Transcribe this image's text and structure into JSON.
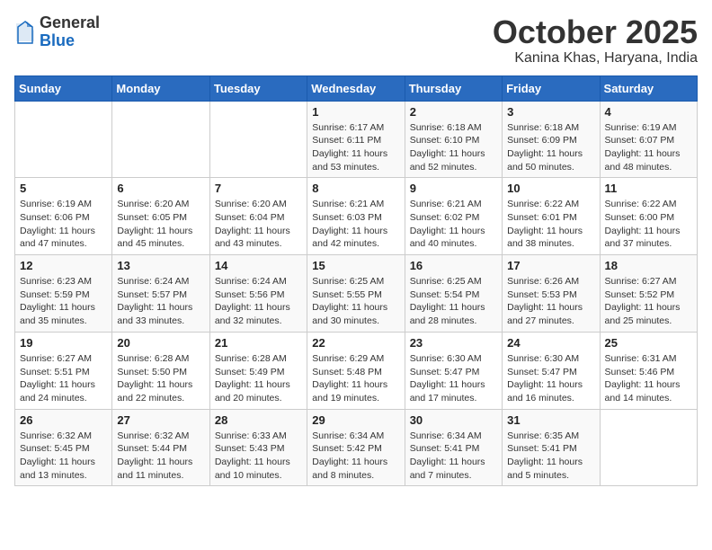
{
  "logo": {
    "general": "General",
    "blue": "Blue"
  },
  "title": "October 2025",
  "location": "Kanina Khas, Haryana, India",
  "days_of_week": [
    "Sunday",
    "Monday",
    "Tuesday",
    "Wednesday",
    "Thursday",
    "Friday",
    "Saturday"
  ],
  "weeks": [
    [
      {
        "day": "",
        "sunrise": "",
        "sunset": "",
        "daylight": ""
      },
      {
        "day": "",
        "sunrise": "",
        "sunset": "",
        "daylight": ""
      },
      {
        "day": "",
        "sunrise": "",
        "sunset": "",
        "daylight": ""
      },
      {
        "day": "1",
        "sunrise": "Sunrise: 6:17 AM",
        "sunset": "Sunset: 6:11 PM",
        "daylight": "Daylight: 11 hours and 53 minutes."
      },
      {
        "day": "2",
        "sunrise": "Sunrise: 6:18 AM",
        "sunset": "Sunset: 6:10 PM",
        "daylight": "Daylight: 11 hours and 52 minutes."
      },
      {
        "day": "3",
        "sunrise": "Sunrise: 6:18 AM",
        "sunset": "Sunset: 6:09 PM",
        "daylight": "Daylight: 11 hours and 50 minutes."
      },
      {
        "day": "4",
        "sunrise": "Sunrise: 6:19 AM",
        "sunset": "Sunset: 6:07 PM",
        "daylight": "Daylight: 11 hours and 48 minutes."
      }
    ],
    [
      {
        "day": "5",
        "sunrise": "Sunrise: 6:19 AM",
        "sunset": "Sunset: 6:06 PM",
        "daylight": "Daylight: 11 hours and 47 minutes."
      },
      {
        "day": "6",
        "sunrise": "Sunrise: 6:20 AM",
        "sunset": "Sunset: 6:05 PM",
        "daylight": "Daylight: 11 hours and 45 minutes."
      },
      {
        "day": "7",
        "sunrise": "Sunrise: 6:20 AM",
        "sunset": "Sunset: 6:04 PM",
        "daylight": "Daylight: 11 hours and 43 minutes."
      },
      {
        "day": "8",
        "sunrise": "Sunrise: 6:21 AM",
        "sunset": "Sunset: 6:03 PM",
        "daylight": "Daylight: 11 hours and 42 minutes."
      },
      {
        "day": "9",
        "sunrise": "Sunrise: 6:21 AM",
        "sunset": "Sunset: 6:02 PM",
        "daylight": "Daylight: 11 hours and 40 minutes."
      },
      {
        "day": "10",
        "sunrise": "Sunrise: 6:22 AM",
        "sunset": "Sunset: 6:01 PM",
        "daylight": "Daylight: 11 hours and 38 minutes."
      },
      {
        "day": "11",
        "sunrise": "Sunrise: 6:22 AM",
        "sunset": "Sunset: 6:00 PM",
        "daylight": "Daylight: 11 hours and 37 minutes."
      }
    ],
    [
      {
        "day": "12",
        "sunrise": "Sunrise: 6:23 AM",
        "sunset": "Sunset: 5:59 PM",
        "daylight": "Daylight: 11 hours and 35 minutes."
      },
      {
        "day": "13",
        "sunrise": "Sunrise: 6:24 AM",
        "sunset": "Sunset: 5:57 PM",
        "daylight": "Daylight: 11 hours and 33 minutes."
      },
      {
        "day": "14",
        "sunrise": "Sunrise: 6:24 AM",
        "sunset": "Sunset: 5:56 PM",
        "daylight": "Daylight: 11 hours and 32 minutes."
      },
      {
        "day": "15",
        "sunrise": "Sunrise: 6:25 AM",
        "sunset": "Sunset: 5:55 PM",
        "daylight": "Daylight: 11 hours and 30 minutes."
      },
      {
        "day": "16",
        "sunrise": "Sunrise: 6:25 AM",
        "sunset": "Sunset: 5:54 PM",
        "daylight": "Daylight: 11 hours and 28 minutes."
      },
      {
        "day": "17",
        "sunrise": "Sunrise: 6:26 AM",
        "sunset": "Sunset: 5:53 PM",
        "daylight": "Daylight: 11 hours and 27 minutes."
      },
      {
        "day": "18",
        "sunrise": "Sunrise: 6:27 AM",
        "sunset": "Sunset: 5:52 PM",
        "daylight": "Daylight: 11 hours and 25 minutes."
      }
    ],
    [
      {
        "day": "19",
        "sunrise": "Sunrise: 6:27 AM",
        "sunset": "Sunset: 5:51 PM",
        "daylight": "Daylight: 11 hours and 24 minutes."
      },
      {
        "day": "20",
        "sunrise": "Sunrise: 6:28 AM",
        "sunset": "Sunset: 5:50 PM",
        "daylight": "Daylight: 11 hours and 22 minutes."
      },
      {
        "day": "21",
        "sunrise": "Sunrise: 6:28 AM",
        "sunset": "Sunset: 5:49 PM",
        "daylight": "Daylight: 11 hours and 20 minutes."
      },
      {
        "day": "22",
        "sunrise": "Sunrise: 6:29 AM",
        "sunset": "Sunset: 5:48 PM",
        "daylight": "Daylight: 11 hours and 19 minutes."
      },
      {
        "day": "23",
        "sunrise": "Sunrise: 6:30 AM",
        "sunset": "Sunset: 5:47 PM",
        "daylight": "Daylight: 11 hours and 17 minutes."
      },
      {
        "day": "24",
        "sunrise": "Sunrise: 6:30 AM",
        "sunset": "Sunset: 5:47 PM",
        "daylight": "Daylight: 11 hours and 16 minutes."
      },
      {
        "day": "25",
        "sunrise": "Sunrise: 6:31 AM",
        "sunset": "Sunset: 5:46 PM",
        "daylight": "Daylight: 11 hours and 14 minutes."
      }
    ],
    [
      {
        "day": "26",
        "sunrise": "Sunrise: 6:32 AM",
        "sunset": "Sunset: 5:45 PM",
        "daylight": "Daylight: 11 hours and 13 minutes."
      },
      {
        "day": "27",
        "sunrise": "Sunrise: 6:32 AM",
        "sunset": "Sunset: 5:44 PM",
        "daylight": "Daylight: 11 hours and 11 minutes."
      },
      {
        "day": "28",
        "sunrise": "Sunrise: 6:33 AM",
        "sunset": "Sunset: 5:43 PM",
        "daylight": "Daylight: 11 hours and 10 minutes."
      },
      {
        "day": "29",
        "sunrise": "Sunrise: 6:34 AM",
        "sunset": "Sunset: 5:42 PM",
        "daylight": "Daylight: 11 hours and 8 minutes."
      },
      {
        "day": "30",
        "sunrise": "Sunrise: 6:34 AM",
        "sunset": "Sunset: 5:41 PM",
        "daylight": "Daylight: 11 hours and 7 minutes."
      },
      {
        "day": "31",
        "sunrise": "Sunrise: 6:35 AM",
        "sunset": "Sunset: 5:41 PM",
        "daylight": "Daylight: 11 hours and 5 minutes."
      },
      {
        "day": "",
        "sunrise": "",
        "sunset": "",
        "daylight": ""
      }
    ]
  ]
}
